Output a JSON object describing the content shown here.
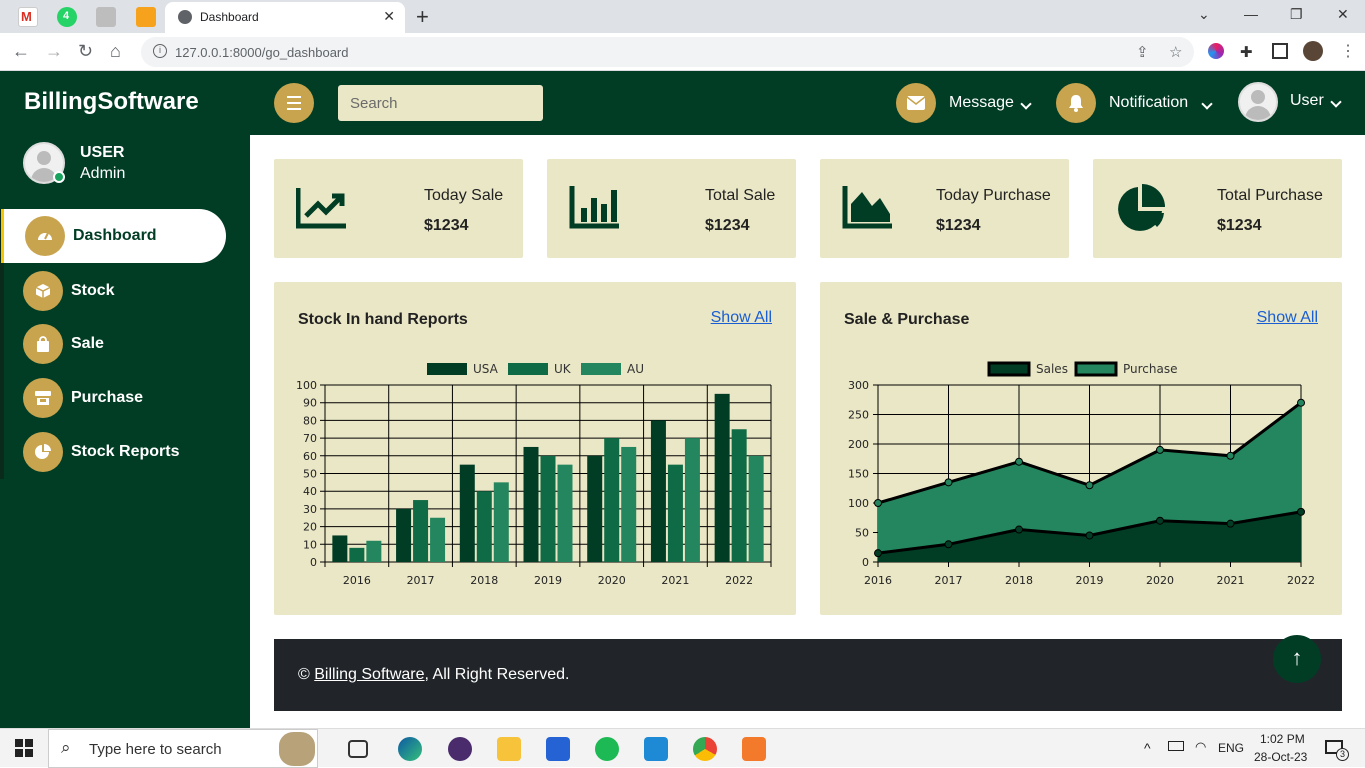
{
  "browser": {
    "tab_title": "Dashboard",
    "url": "127.0.0.1:8000/go_dashboard",
    "pinned_badge": "4"
  },
  "brand": "BillingSoftware",
  "profile": {
    "name": "USER",
    "role": "Admin"
  },
  "nav": [
    {
      "label": "Dashboard",
      "icon": "gauge-icon",
      "active": true
    },
    {
      "label": "Stock",
      "icon": "box-icon",
      "active": false
    },
    {
      "label": "Sale",
      "icon": "shopping-bag-icon",
      "active": false
    },
    {
      "label": "Purchase",
      "icon": "store-icon",
      "active": false
    },
    {
      "label": "Stock Reports",
      "icon": "pie-chart-icon",
      "active": false
    }
  ],
  "topbar": {
    "search_placeholder": "Search",
    "message_label": "Message",
    "notification_label": "Notification",
    "user_label": "User"
  },
  "stats": [
    {
      "title": "Today Sale",
      "value": "$1234",
      "icon": "chart-line-icon"
    },
    {
      "title": "Total Sale",
      "value": "$1234",
      "icon": "chart-bar-icon"
    },
    {
      "title": "Today Purchase",
      "value": "$1234",
      "icon": "chart-area-icon"
    },
    {
      "title": "Total Purchase",
      "value": "$1234",
      "icon": "chart-pie-icon"
    }
  ],
  "stock_card": {
    "title": "Stock In hand Reports",
    "link": "Show All"
  },
  "sale_card": {
    "title": "Sale & Purchase",
    "link": "Show All"
  },
  "chart_data": [
    {
      "type": "bar",
      "categories": [
        "2016",
        "2017",
        "2018",
        "2019",
        "2020",
        "2021",
        "2022"
      ],
      "series": [
        {
          "name": "USA",
          "color": "#013d25",
          "values": [
            15,
            30,
            55,
            65,
            60,
            80,
            95
          ]
        },
        {
          "name": "UK",
          "color": "#0f6b45",
          "values": [
            8,
            35,
            40,
            60,
            70,
            55,
            75
          ]
        },
        {
          "name": "AU",
          "color": "#23865e",
          "values": [
            12,
            25,
            45,
            55,
            65,
            70,
            60
          ]
        }
      ],
      "ylim": [
        0,
        100
      ],
      "yticks": [
        0,
        10,
        20,
        30,
        40,
        50,
        60,
        70,
        80,
        90,
        100
      ],
      "grid": true,
      "legend": "top"
    },
    {
      "type": "area",
      "categories": [
        "2016",
        "2017",
        "2018",
        "2019",
        "2020",
        "2021",
        "2022"
      ],
      "series": [
        {
          "name": "Sales",
          "color": "#013d25",
          "values": [
            15,
            30,
            55,
            45,
            70,
            65,
            85
          ]
        },
        {
          "name": "Purchase",
          "color": "#23865e",
          "values": [
            100,
            135,
            170,
            130,
            190,
            180,
            270
          ]
        }
      ],
      "ylim": [
        0,
        300
      ],
      "yticks": [
        0,
        50,
        100,
        150,
        200,
        250,
        300
      ],
      "grid": true,
      "legend": "top"
    }
  ],
  "footer": {
    "prefix": "©",
    "link": "Billing Software",
    "suffix": ", All Right Reserved."
  },
  "taskbar": {
    "search_placeholder": "Type here to search",
    "time": "1:02 PM",
    "date": "28-Oct-23",
    "lang": "ENG",
    "notif_count": "3"
  }
}
